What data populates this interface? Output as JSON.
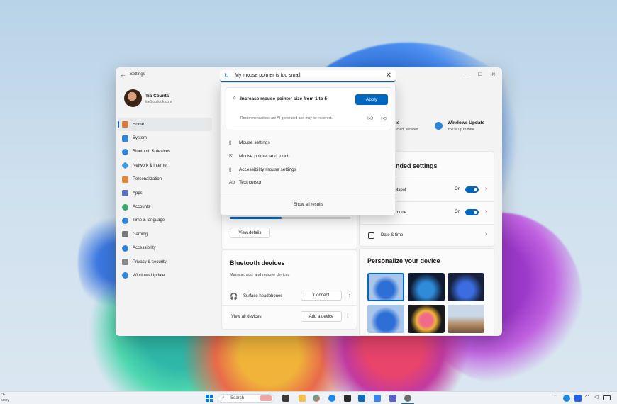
{
  "window": {
    "title": "Settings",
    "back_glyph": "←",
    "minimize": "—",
    "maximize": "☐",
    "close": "✕"
  },
  "search": {
    "value": "My mouse pointer is too small",
    "clear_glyph": "✕"
  },
  "profile": {
    "name": "Tia Counts",
    "email": "tia@outlook.com"
  },
  "sidebar": {
    "items": [
      {
        "label": "Home",
        "icon": "home-icon",
        "color": "#d97a3a"
      },
      {
        "label": "System",
        "icon": "system-icon",
        "color": "#2f86d8"
      },
      {
        "label": "Bluetooth & devices",
        "icon": "bluetooth-icon",
        "color": "#2f86d8"
      },
      {
        "label": "Network & internet",
        "icon": "network-icon",
        "color": "#3a9be0"
      },
      {
        "label": "Personalization",
        "icon": "personalization-icon",
        "color": "#e0873a"
      },
      {
        "label": "Apps",
        "icon": "apps-icon",
        "color": "#5a6fb8"
      },
      {
        "label": "Accounts",
        "icon": "accounts-icon",
        "color": "#3aa36b"
      },
      {
        "label": "Time & language",
        "icon": "time-language-icon",
        "color": "#2f86d8"
      },
      {
        "label": "Gaming",
        "icon": "gaming-icon",
        "color": "#777777"
      },
      {
        "label": "Accessibility",
        "icon": "accessibility-icon",
        "color": "#2f86d8"
      },
      {
        "label": "Privacy & security",
        "icon": "privacy-icon",
        "color": "#888888"
      },
      {
        "label": "Windows Update",
        "icon": "windows-update-icon",
        "color": "#2f86d8"
      }
    ]
  },
  "status": {
    "home_title": "me",
    "home_sub": "nected, secured",
    "update_title": "Windows Update",
    "update_sub": "You're up to date"
  },
  "recommended": {
    "title": "ended settings",
    "rows": [
      {
        "label": "hotspot",
        "state": "On"
      },
      {
        "label": "e mode",
        "state": "On"
      },
      {
        "label": "Date & time",
        "state": ""
      }
    ]
  },
  "storage": {
    "view_details": "View details"
  },
  "bluetooth": {
    "title": "Bluetooth devices",
    "subtitle": "Manage, add, and remove devices",
    "device": "Surface headphones",
    "connect": "Connect",
    "view_all": "View all devices",
    "add_device": "Add a device"
  },
  "personalize": {
    "title": "Personalize your device"
  },
  "dropdown": {
    "recommendation": "Increase mouse pointer size from 1 to 5",
    "apply": "Apply",
    "disclaimer": "Recommendations are AI-generated and may be incorrect.",
    "results": [
      {
        "label": "Mouse settings",
        "icon": "mouse-icon",
        "glyph": "▯"
      },
      {
        "label": "Mouse pointer and touch",
        "icon": "pointer-touch-icon",
        "glyph": "⇱"
      },
      {
        "label": "Accessibility mouse settings",
        "icon": "mouse-icon",
        "glyph": "▯"
      },
      {
        "label": "Text cursor",
        "icon": "text-cursor-icon",
        "glyph": "Ab"
      }
    ],
    "show_all": "Show all results"
  },
  "taskbar": {
    "search": "Search",
    "weather_temp": "°F",
    "weather_sub": "unny",
    "accent": "#0067c0"
  }
}
